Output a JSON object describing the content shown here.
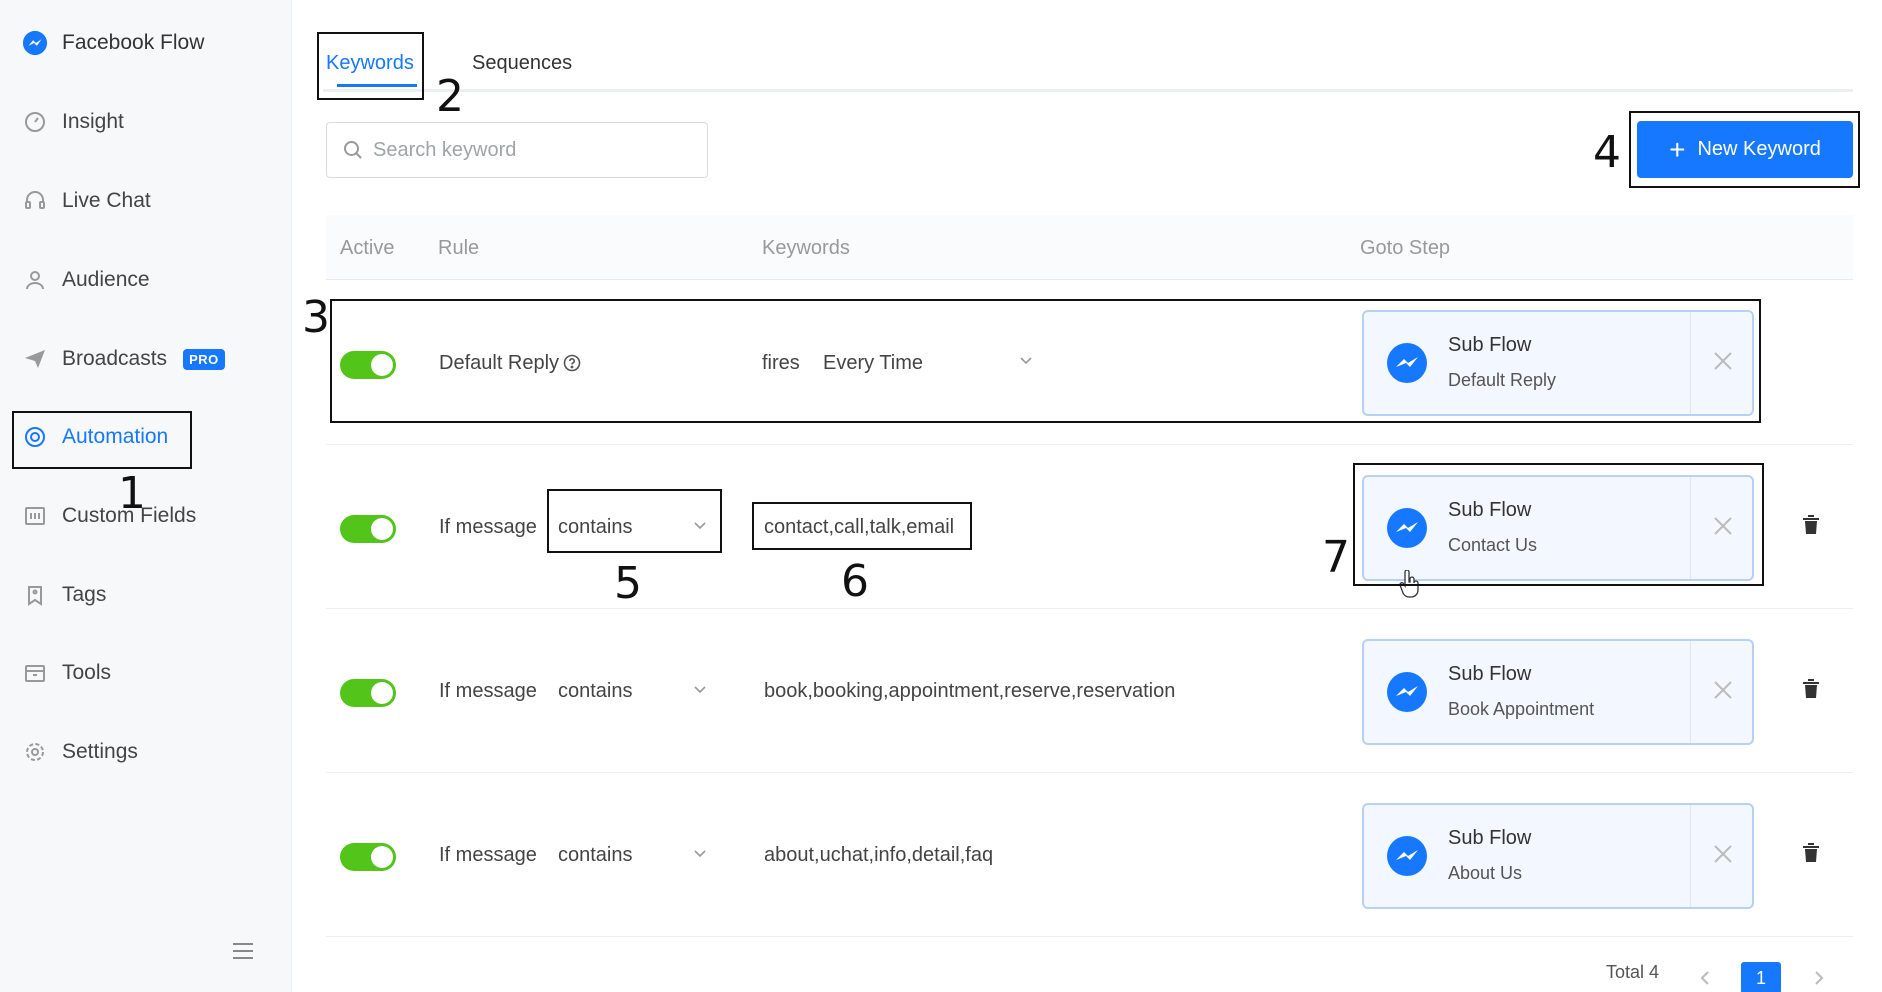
{
  "sidebar": {
    "brand": "Facebook Flow",
    "items": [
      {
        "label": "Insight"
      },
      {
        "label": "Live Chat"
      },
      {
        "label": "Audience"
      },
      {
        "label": "Broadcasts",
        "badge": "PRO"
      },
      {
        "label": "Automation"
      },
      {
        "label": "Custom Fields"
      },
      {
        "label": "Tags"
      },
      {
        "label": "Tools"
      },
      {
        "label": "Settings"
      }
    ]
  },
  "tabs": [
    {
      "label": "Keywords"
    },
    {
      "label": "Sequences"
    }
  ],
  "search": {
    "placeholder": "Search keyword"
  },
  "new_keyword_label": "New Keyword",
  "table": {
    "headers": [
      "Active",
      "Rule",
      "Keywords",
      "Goto Step"
    ],
    "rows": [
      {
        "rule": "Default Reply",
        "fires": "fires",
        "condition": "Every Time",
        "goto_title": "Sub Flow",
        "goto_name": "Default Reply"
      },
      {
        "rule": "If message",
        "condition": "contains",
        "keywords": "contact,call,talk,email",
        "goto_title": "Sub Flow",
        "goto_name": "Contact Us"
      },
      {
        "rule": "If message",
        "condition": "contains",
        "keywords": "book,booking,appointment,reserve,reservation",
        "goto_title": "Sub Flow",
        "goto_name": "Book Appointment"
      },
      {
        "rule": "If message",
        "condition": "contains",
        "keywords": "about,uchat,info,detail,faq",
        "goto_title": "Sub Flow",
        "goto_name": "About Us"
      }
    ]
  },
  "pagination": {
    "total": "Total 4",
    "current": "1"
  },
  "annotations": [
    "1",
    "2",
    "3",
    "4",
    "5",
    "6",
    "7"
  ],
  "colors": {
    "accent": "#1677ff",
    "toggle_on": "#52c41a"
  }
}
